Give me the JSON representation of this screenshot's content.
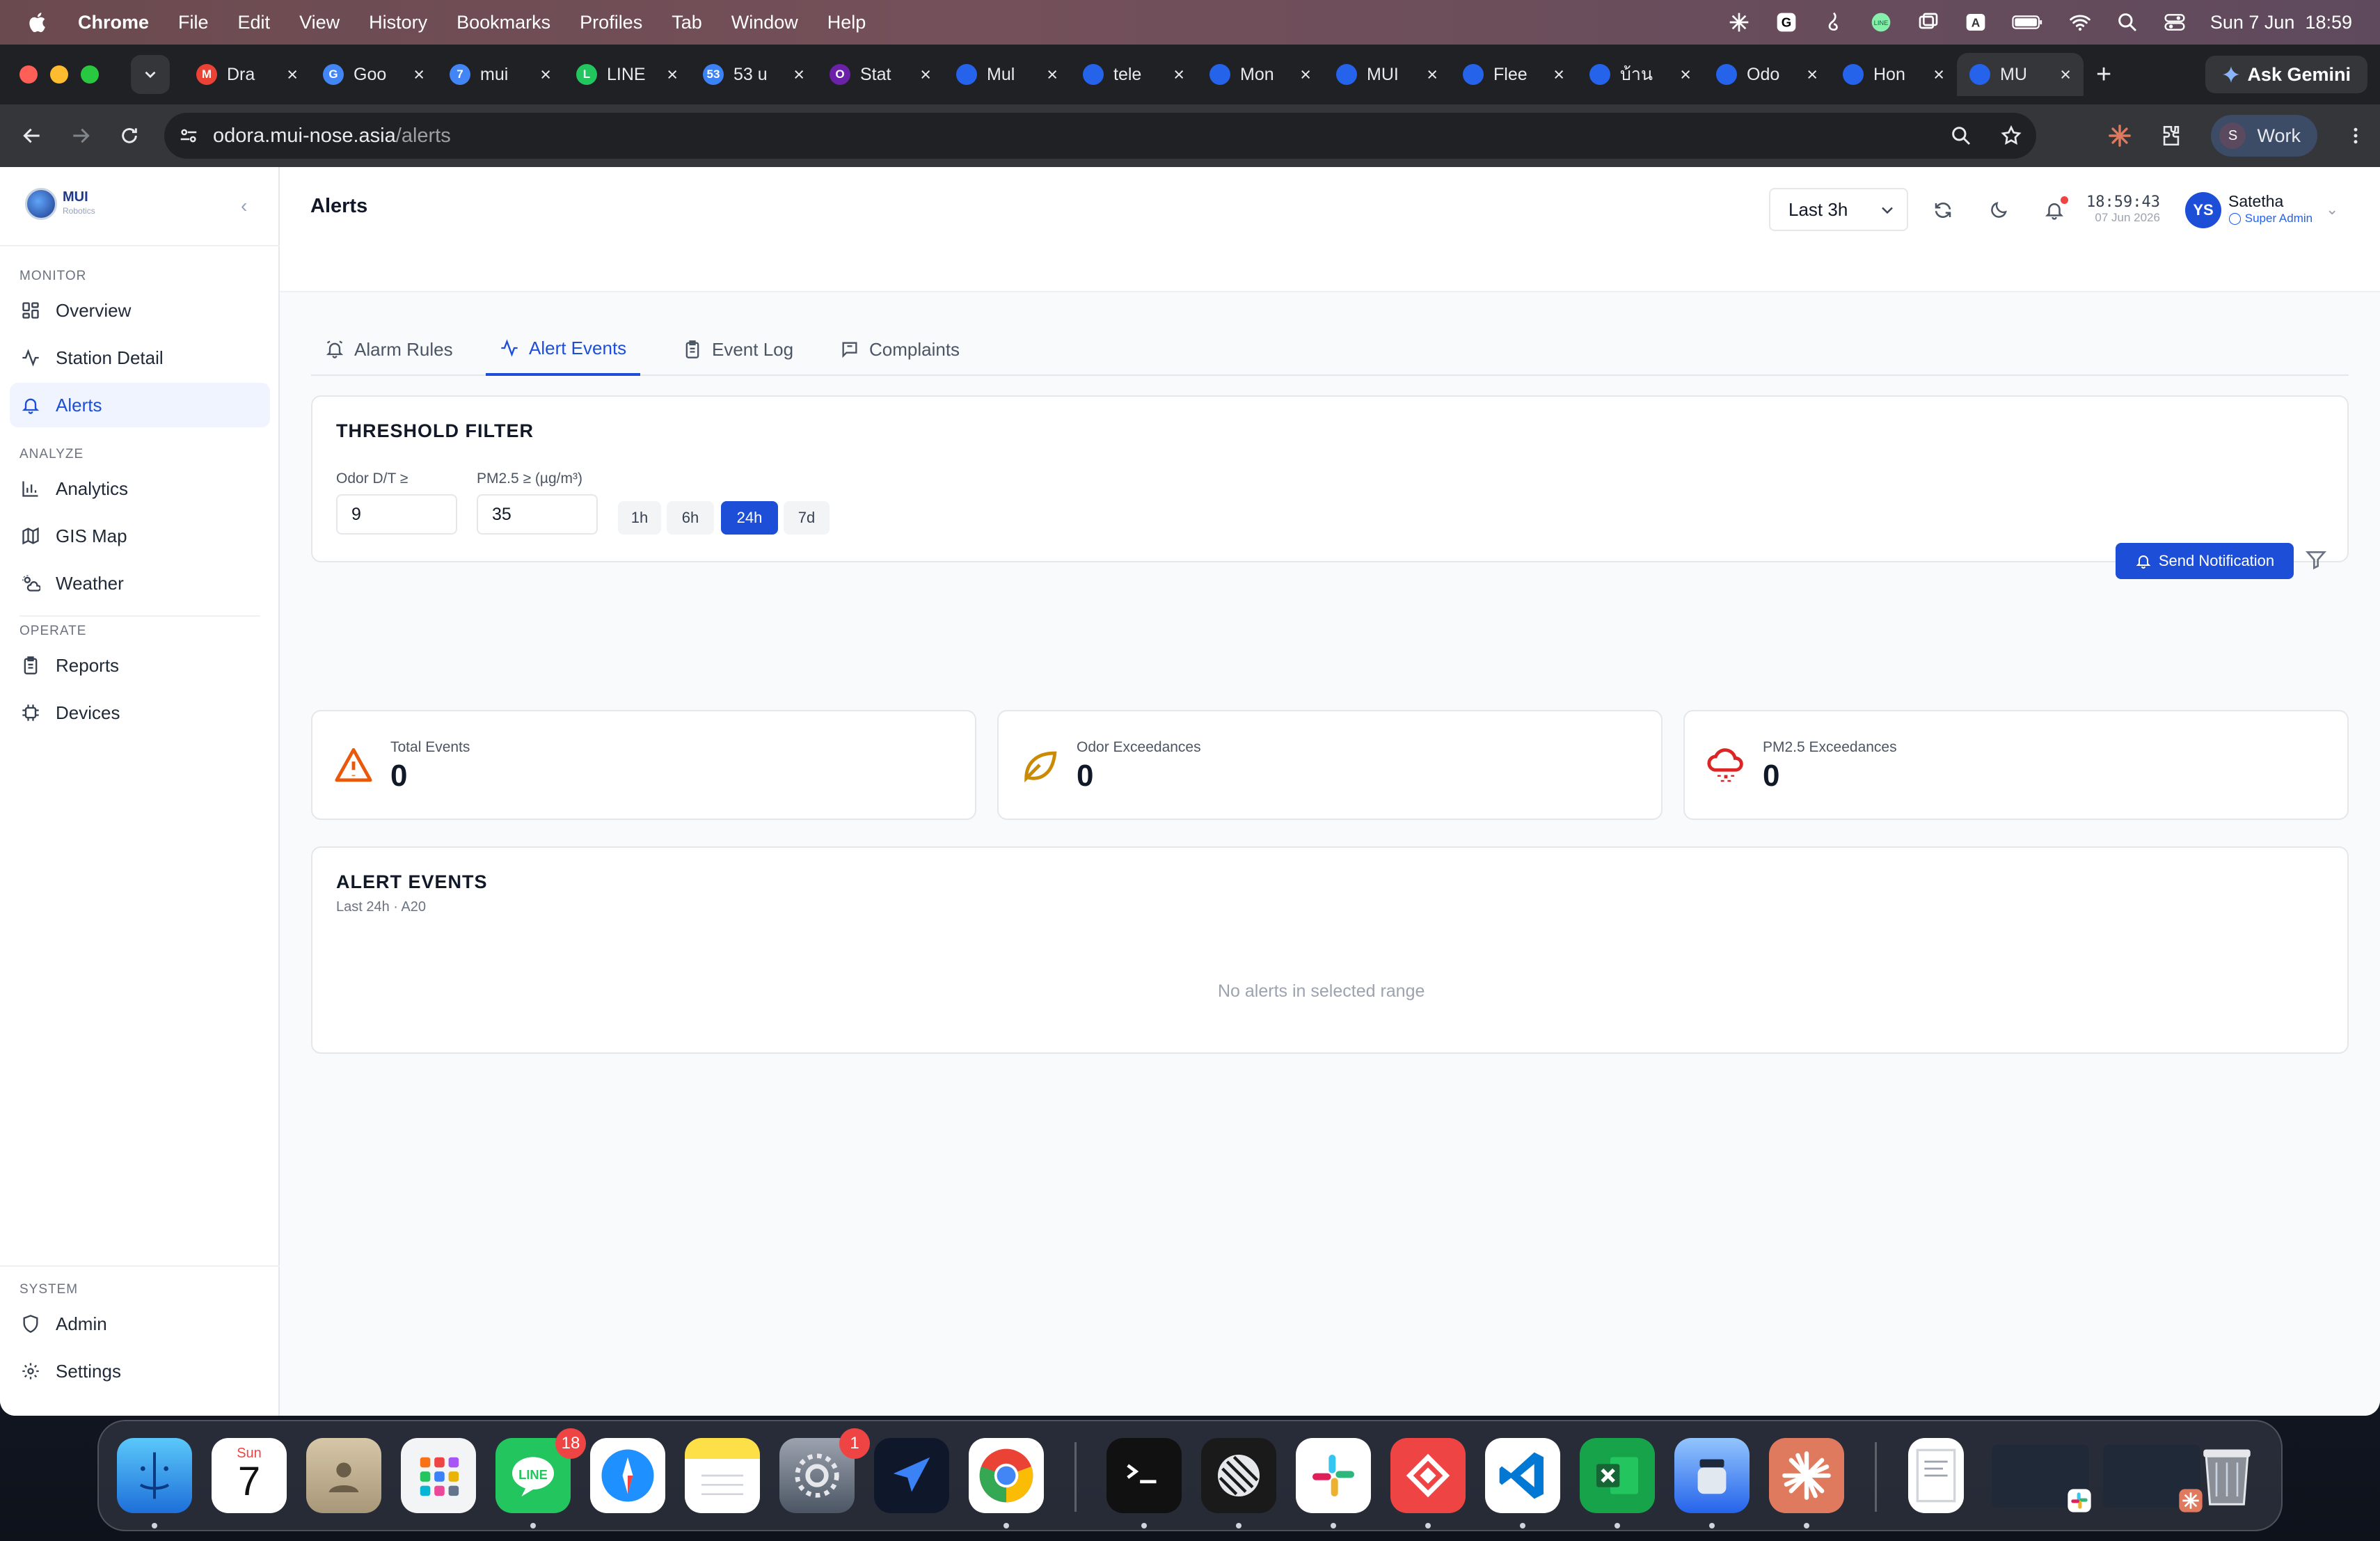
{
  "menubar": {
    "app": "Chrome",
    "items": [
      "File",
      "Edit",
      "View",
      "History",
      "Bookmarks",
      "Profiles",
      "Tab",
      "Window",
      "Help"
    ],
    "input_source": "A",
    "datetime": "Sun 7 Jun  18:59"
  },
  "browser": {
    "tabs": [
      {
        "title": "Dra",
        "icon": "gmail-icon",
        "color": "#ea4335",
        "glyph": "M"
      },
      {
        "title": "Goo",
        "icon": "google-translate-icon",
        "color": "#4285f4",
        "glyph": "G"
      },
      {
        "title": "mui",
        "icon": "document-icon",
        "color": "#4285f4",
        "glyph": "7"
      },
      {
        "title": "LINE",
        "icon": "shield-icon",
        "color": "#22c55e",
        "glyph": "L"
      },
      {
        "title": "53 u",
        "icon": "badge-icon",
        "color": "#3b82f6",
        "glyph": "53"
      },
      {
        "title": "Stat",
        "icon": "circle-icon",
        "color": "#6b21a8",
        "glyph": "O"
      },
      {
        "title": "Mul",
        "icon": "globe-icon",
        "color": "#2563eb",
        "glyph": ""
      },
      {
        "title": "tele",
        "icon": "globe-icon",
        "color": "#2563eb",
        "glyph": ""
      },
      {
        "title": "Mon",
        "icon": "globe-icon",
        "color": "#2563eb",
        "glyph": ""
      },
      {
        "title": "MUI",
        "icon": "globe-icon",
        "color": "#2563eb",
        "glyph": ""
      },
      {
        "title": "Flee",
        "icon": "globe-icon",
        "color": "#2563eb",
        "glyph": ""
      },
      {
        "title": "บ้าน",
        "icon": "globe-icon",
        "color": "#2563eb",
        "glyph": ""
      },
      {
        "title": "Odo",
        "icon": "globe-icon",
        "color": "#2563eb",
        "glyph": ""
      },
      {
        "title": "Hon",
        "icon": "globe-icon",
        "color": "#2563eb",
        "glyph": ""
      },
      {
        "title": "MU",
        "icon": "globe-icon",
        "color": "#2563eb",
        "glyph": "",
        "active": true
      }
    ],
    "ask_gemini": "Ask Gemini",
    "url_host": "odora.mui-nose.asia",
    "url_path": "/alerts",
    "profile_initial": "S",
    "profile_name": "Work"
  },
  "sidebar": {
    "brand": "MUI",
    "brand_sub": "Robotics",
    "sections": {
      "monitor": "MONITOR",
      "analyze": "ANALYZE",
      "operate": "OPERATE",
      "system": "SYSTEM"
    },
    "items": {
      "overview": "Overview",
      "station_detail": "Station Detail",
      "alerts": "Alerts",
      "analytics": "Analytics",
      "gis_map": "GIS Map",
      "weather": "Weather",
      "reports": "Reports",
      "devices": "Devices",
      "admin": "Admin",
      "settings": "Settings"
    }
  },
  "header": {
    "title": "Alerts",
    "range": "Last 3h",
    "time": "18:59:43",
    "date": "07 Jun 2026",
    "user_initials": "YS",
    "user_name": "Satetha",
    "user_role": "Super Admin"
  },
  "tabs": {
    "alarm_rules": "Alarm Rules",
    "alert_events": "Alert Events",
    "event_log": "Event Log",
    "complaints": "Complaints"
  },
  "threshold": {
    "title": "THRESHOLD FILTER",
    "odor_label": "Odor D/T ≥",
    "odor_value": "9",
    "pm_label": "PM2.5 ≥ (µg/m³)",
    "pm_value": "35",
    "ranges": [
      "1h",
      "6h",
      "24h",
      "7d"
    ],
    "selected_range": "24h",
    "send_label": "Send Notification"
  },
  "stats": {
    "total_label": "Total Events",
    "total_value": "0",
    "odor_label": "Odor Exceedances",
    "odor_value": "0",
    "pm_label": "PM2.5 Exceedances",
    "pm_value": "0"
  },
  "events": {
    "title": "ALERT EVENTS",
    "subtitle": "Last 24h · A20",
    "empty": "No alerts in selected range"
  },
  "dock": {
    "calendar_month": "Sun",
    "calendar_day": "7",
    "line_badge": "18",
    "settings_badge": "1"
  },
  "colors": {
    "primary": "#1d4ed8",
    "warning": "#ea580c",
    "odor": "#ca8a04",
    "pm": "#dc2626"
  }
}
